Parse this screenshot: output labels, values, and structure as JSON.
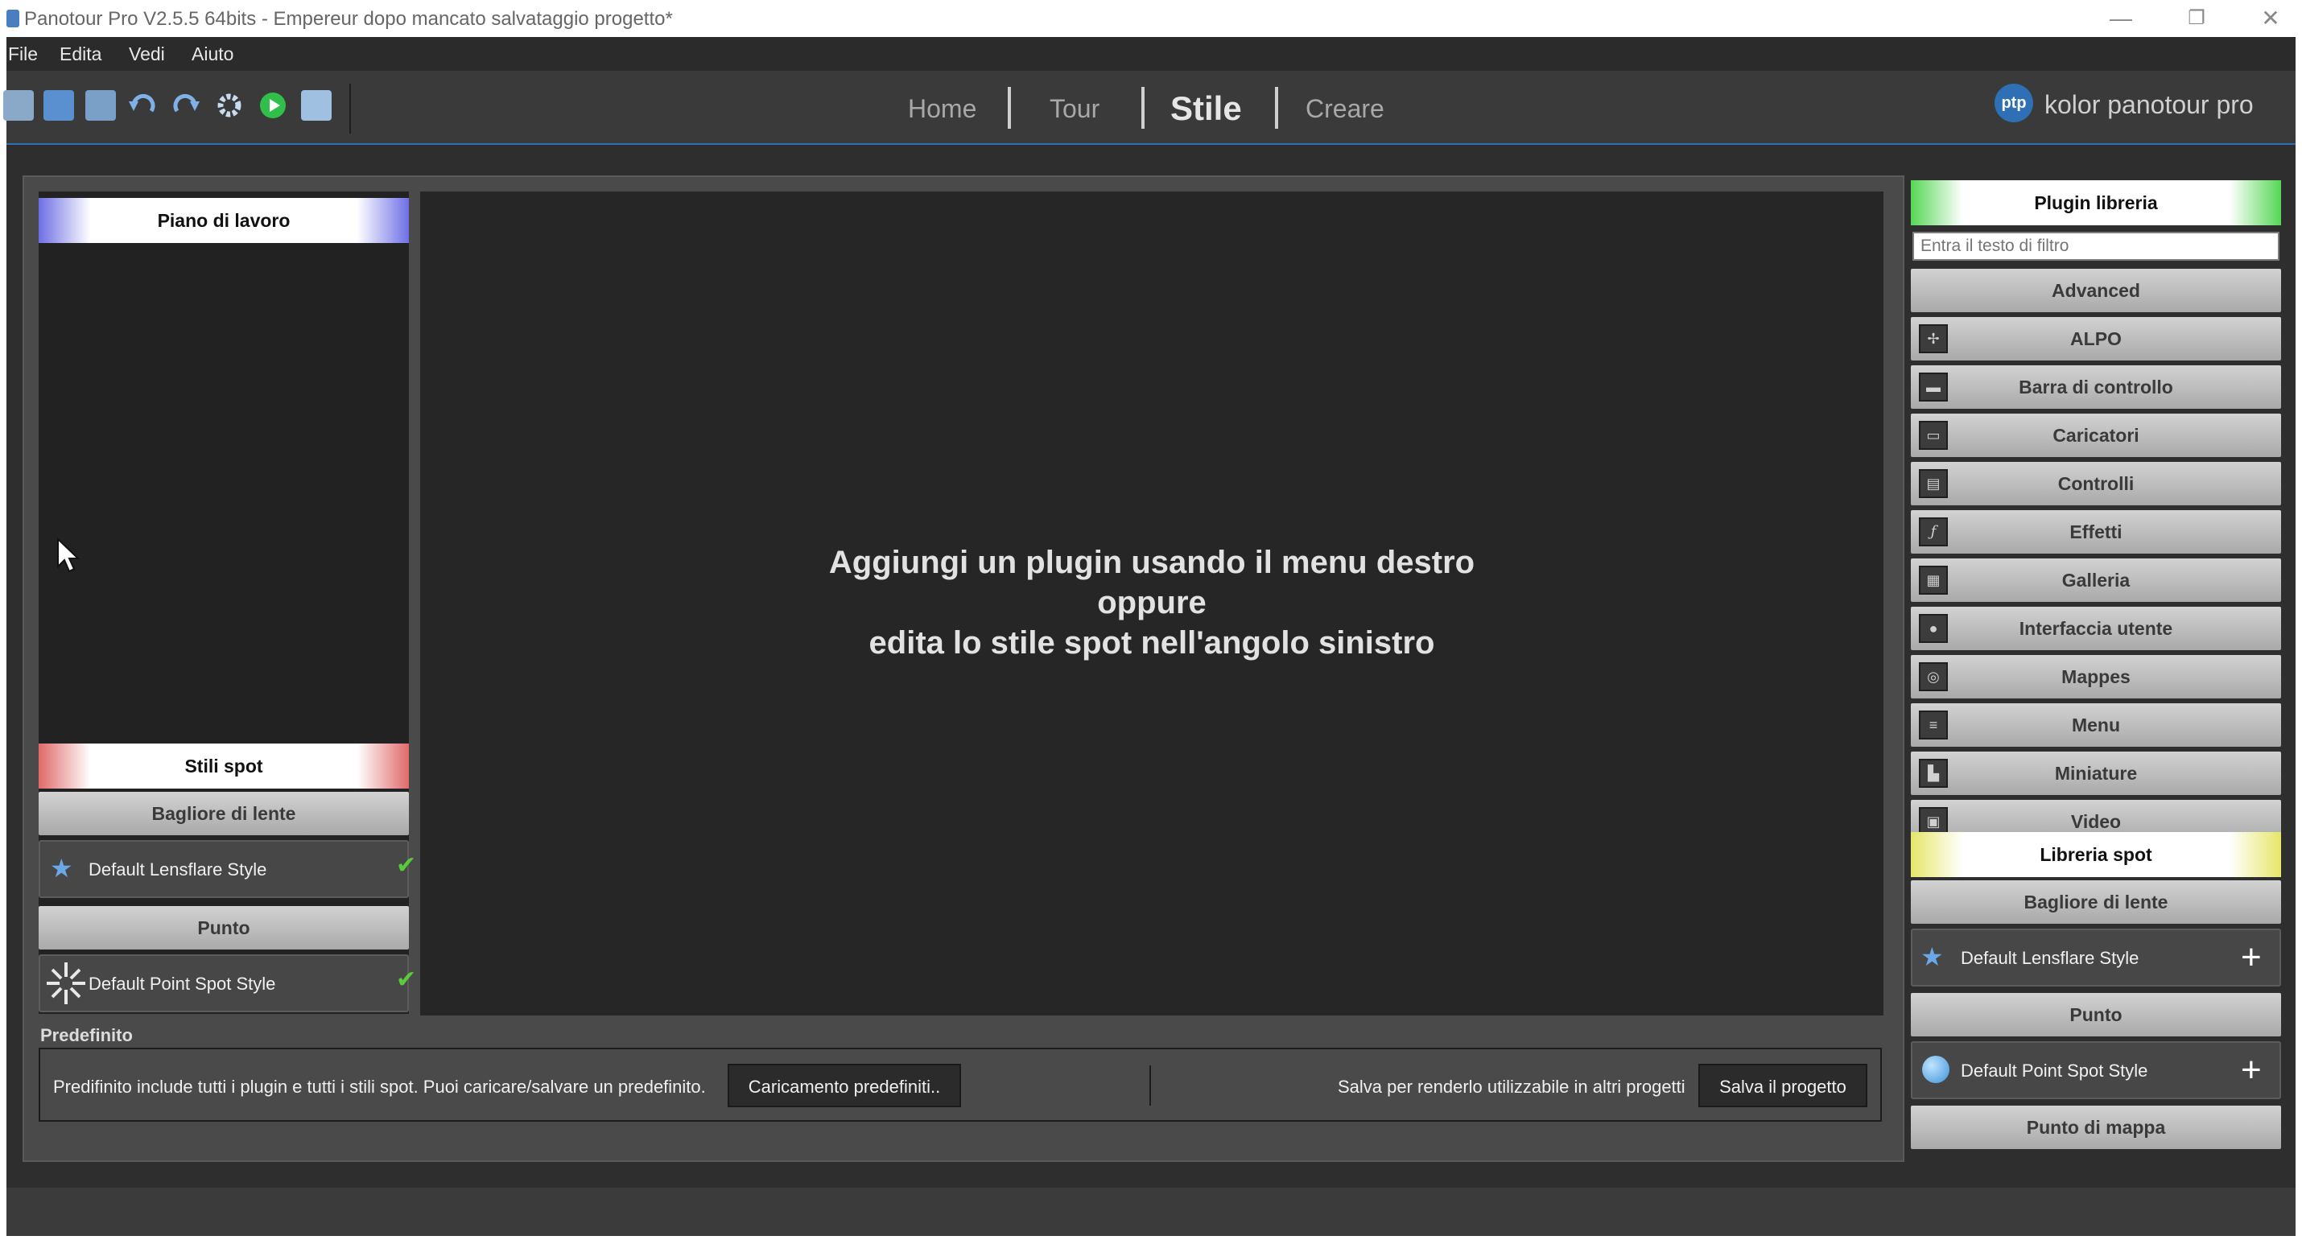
{
  "window": {
    "title": "Panotour Pro V2.5.5 64bits - Empereur dopo mancato salvataggio progetto*",
    "minimize": "—",
    "restore": "❐",
    "close": "✕"
  },
  "menu": [
    "File",
    "Edita",
    "Vedi",
    "Aiuto"
  ],
  "toolbar_icons": [
    "open-folder-icon",
    "save-icon",
    "add-image-icon",
    "undo-icon",
    "redo-icon",
    "settings-gear-icon",
    "play-icon",
    "publish-folder-icon"
  ],
  "nav_tabs": [
    {
      "label": "Home",
      "active": false
    },
    {
      "label": "Tour",
      "active": false
    },
    {
      "label": "Stile",
      "active": true
    },
    {
      "label": "Creare",
      "active": false
    }
  ],
  "brand": {
    "logo": "ptp",
    "name": "kolor panotour pro"
  },
  "left_panel": {
    "workspace_header": "Piano di lavoro",
    "spot_styles_header": "Stili spot",
    "lensflare_category": "Bagliore di lente",
    "lensflare_item": "Default Lensflare Style",
    "point_category": "Punto",
    "point_item": "Default Point Spot Style"
  },
  "center": {
    "line1": "Aggiungi un plugin usando il menu destro",
    "line2": "oppure",
    "line3": "edita lo stile spot nell'angolo sinistro"
  },
  "preset": {
    "label": "Predefinito",
    "description": "Predifinito include tutti i plugin e tutti i stili spot. Puoi caricare/salvare un predefinito.",
    "load_button": "Caricamento predefiniti..",
    "save_hint": "Salva per renderlo utilizzabile in altri progetti",
    "save_button": "Salva il progetto"
  },
  "right_panel": {
    "plugin_header": "Plugin libreria",
    "filter_placeholder": "Entra il testo di filtro",
    "advanced": "Advanced",
    "plugins": [
      {
        "label": "ALPO",
        "icon": "alpo-icon"
      },
      {
        "label": "Barra di controllo",
        "icon": "control-bar-icon"
      },
      {
        "label": "Caricatori",
        "icon": "loaders-icon"
      },
      {
        "label": "Controlli",
        "icon": "controls-icon"
      },
      {
        "label": "Effetti",
        "icon": "effects-fx-icon"
      },
      {
        "label": "Galleria",
        "icon": "gallery-icon"
      },
      {
        "label": "Interfaccia utente",
        "icon": "user-interface-icon"
      },
      {
        "label": "Mappes",
        "icon": "maps-globe-icon"
      },
      {
        "label": "Menu",
        "icon": "menu-icon"
      },
      {
        "label": "Miniature",
        "icon": "thumbnails-icon"
      },
      {
        "label": "Video",
        "icon": "video-icon"
      }
    ],
    "spot_library_header": "Libreria spot",
    "lensflare_category": "Bagliore di lente",
    "lensflare_item": "Default Lensflare Style",
    "point_category": "Punto",
    "point_item": "Default Point Spot Style",
    "map_point_category": "Punto di mappa"
  }
}
